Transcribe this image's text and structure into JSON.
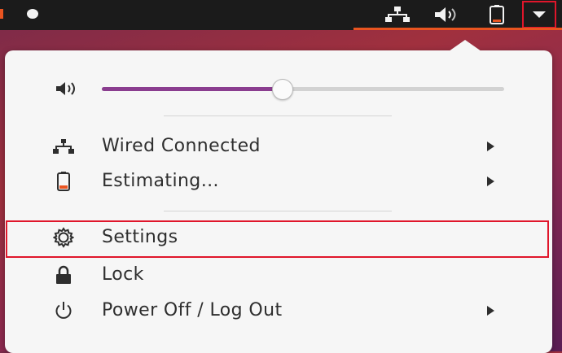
{
  "topbar": {
    "indicators": {
      "network_icon": "network-wired-icon",
      "volume_icon": "volume-icon",
      "battery_icon": "battery-icon",
      "menu_icon": "dropdown-arrow-icon"
    }
  },
  "system_menu": {
    "volume": {
      "icon": "speaker-icon",
      "level": 0.45
    },
    "items": [
      {
        "label": "Wired Connected",
        "icon": "network-wired-icon",
        "has_submenu": true
      },
      {
        "label": "Estimating…",
        "icon": "battery-icon",
        "has_submenu": true
      },
      {
        "label": "Settings",
        "icon": "gear-icon",
        "has_submenu": false,
        "highlighted": true
      },
      {
        "label": "Lock",
        "icon": "lock-icon",
        "has_submenu": false
      },
      {
        "label": "Power Off / Log Out",
        "icon": "power-icon",
        "has_submenu": true
      }
    ]
  },
  "colors": {
    "accent_orange": "#e95420",
    "slider_fill": "#8a3d8f",
    "highlight_border": "#e0162b",
    "popover_bg": "#f6f6f6",
    "topbar_bg": "#1b1b1b"
  }
}
